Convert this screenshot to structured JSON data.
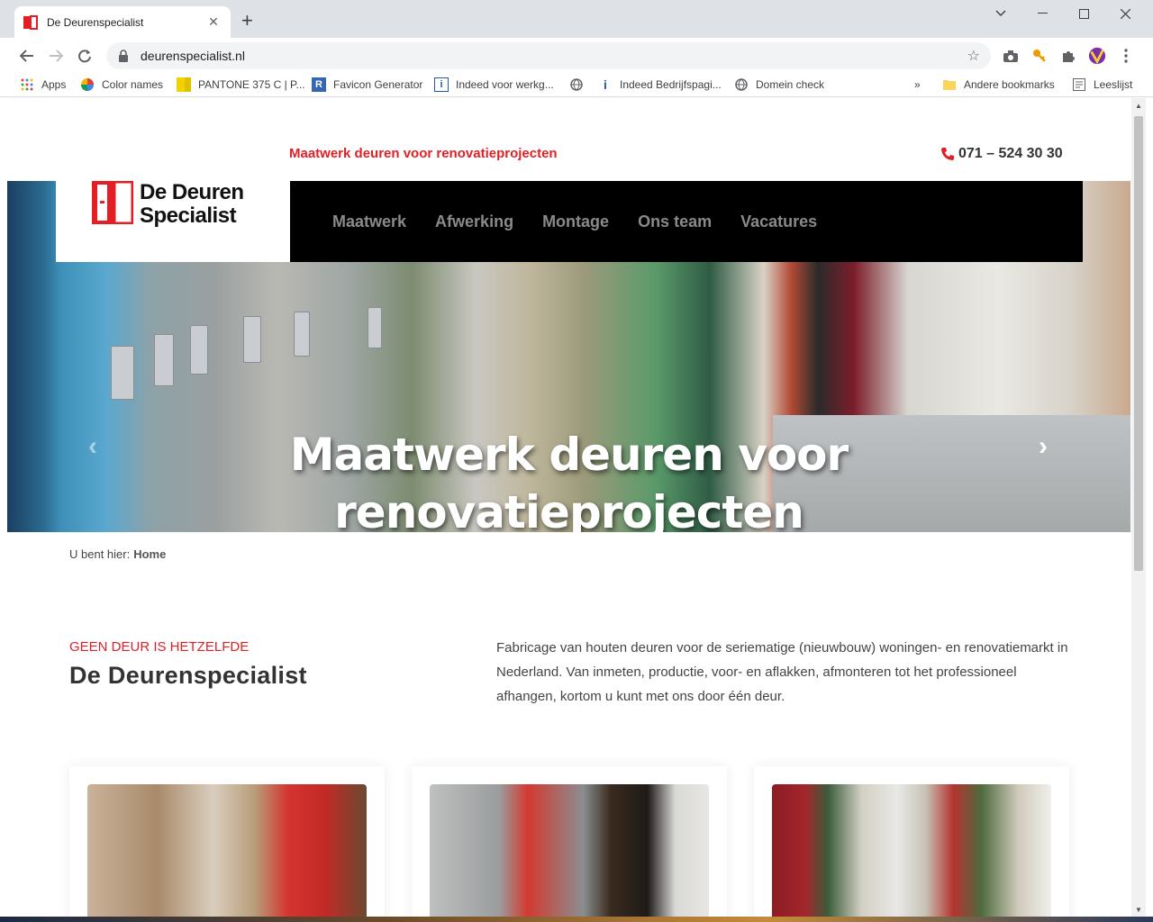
{
  "browser": {
    "tab_title": "De Deurenspecialist",
    "tab_close": "✕",
    "new_tab": "+",
    "url": "deurenspecialist.nl",
    "bookmarks": [
      {
        "label": "Apps"
      },
      {
        "label": "Color names"
      },
      {
        "label": "PANTONE 375 C | P..."
      },
      {
        "label": "Favicon Generator"
      },
      {
        "label": "Indeed voor werkg..."
      },
      {
        "label": ""
      },
      {
        "label": "Indeed Bedrijfspagi..."
      },
      {
        "label": "Domein check"
      }
    ],
    "overflow": "»",
    "other_bookmarks": "Andere bookmarks",
    "reading_list": "Leeslijst"
  },
  "site": {
    "tagline": "Maatwerk deuren voor renovatieprojecten",
    "phone": "071 – 524 30 30",
    "logo_line1": "De Deuren",
    "logo_line2": "Specialist",
    "nav": [
      "Maatwerk",
      "Afwerking",
      "Montage",
      "Ons team",
      "Vacatures"
    ],
    "hero_line1": "Maatwerk deuren voor",
    "hero_line2": "renovatieprojecten",
    "slider_active": 3,
    "breadcrumb_label": "U bent hier:",
    "breadcrumb_home": "Home",
    "eyebrow": "GEEN DEUR IS HETZELFDE",
    "section_title": "De Deurenspecialist",
    "intro": "Fabricage van houten deuren voor de seriematige (nieuwbouw) woningen- en renovatiemarkt in Nederland. Van inmeten, productie, voor- en aflakken, afmonteren tot het professioneel afhangen, kortom u kunt met ons door één deur."
  },
  "colors": {
    "brand_red": "#e31e24",
    "nav_bg": "#000000",
    "nav_text": "#8a8a8a"
  }
}
